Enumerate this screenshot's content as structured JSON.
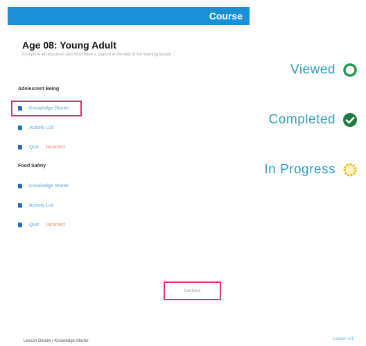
{
  "header": {
    "title": "Course"
  },
  "page": {
    "title": "Age 08: Young Adult",
    "subtitle": "Complete all resources you must have a chance at the end of the learning lesson"
  },
  "sections": [
    {
      "title": "Adolescent Being",
      "items": [
        {
          "label": "Knowledge Starter",
          "status": ""
        },
        {
          "label": "Activity List",
          "status": ""
        },
        {
          "label": "Quiz",
          "status": "Incorrect"
        }
      ]
    },
    {
      "title": "Food Safety",
      "items": [
        {
          "label": "Knowledge Starter",
          "status": ""
        },
        {
          "label": "Activity List",
          "status": ""
        },
        {
          "label": "Quiz",
          "status": "Incorrect"
        }
      ]
    }
  ],
  "continue_button": {
    "label": "Continue"
  },
  "breadcrumb": "Lesson Details / Knowledge Starter",
  "page_number": "Lesson 1/1",
  "legend": {
    "viewed": "Viewed",
    "completed": "Completed",
    "in_progress": "In Progress"
  },
  "colors": {
    "header": "#1b8fd6",
    "viewed": "#1f9d4a",
    "completed": "#1f7a3e",
    "in_progress": "#f2b51a",
    "highlight": "#e0306a",
    "status_incorrect": "#f0765b"
  }
}
